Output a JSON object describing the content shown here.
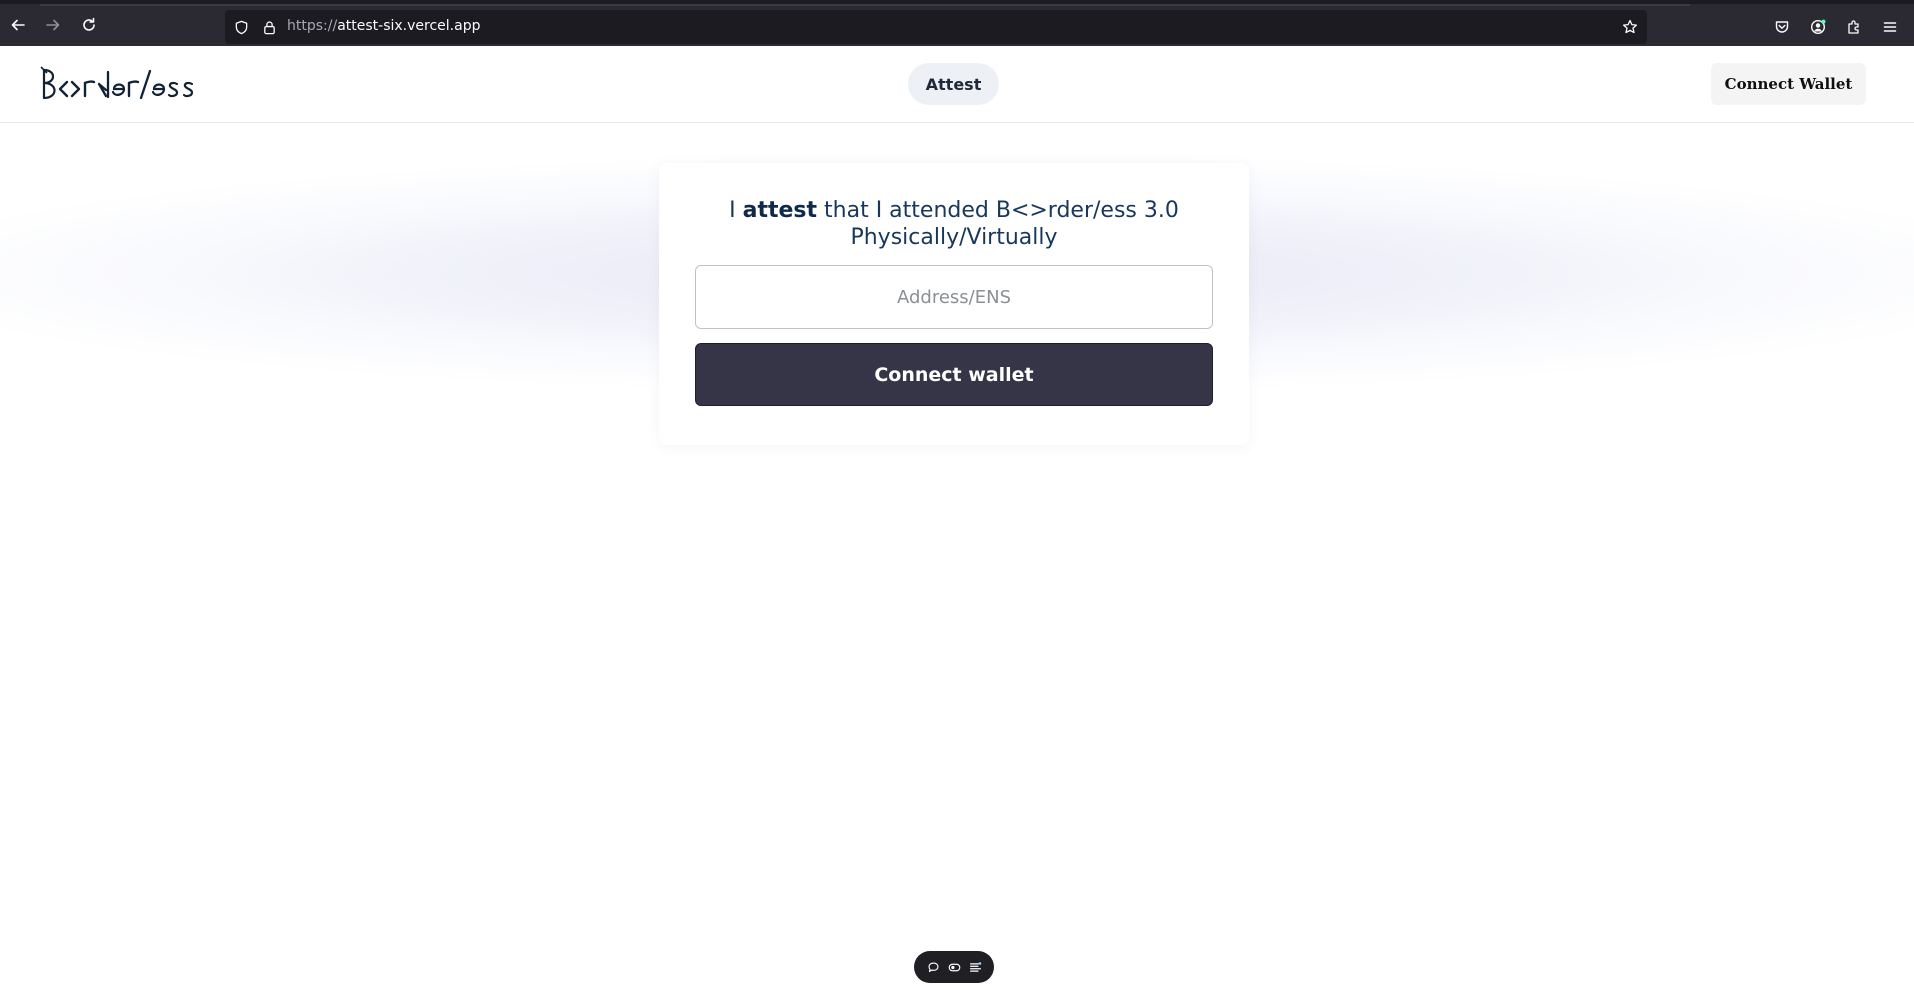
{
  "browser": {
    "url_scheme": "https://",
    "url_host": "attest-six.vercel.app",
    "icons": [
      "back-icon",
      "forward-icon",
      "reload-icon",
      "shield-icon",
      "lock-icon",
      "star-icon",
      "pocket-icon",
      "account-icon",
      "extensions-icon",
      "menu-icon"
    ]
  },
  "header": {
    "logo_text": "B<>rder/ess",
    "nav_label": "Attest",
    "connect_label": "Connect Wallet"
  },
  "card": {
    "heading_prefix": "I ",
    "heading_bold": "attest",
    "heading_rest": " that I attended B<>rder/ess 3.0",
    "heading_line2": "Physically/Virtually",
    "input_placeholder": "Address/ENS",
    "button_label": "Connect wallet"
  },
  "floating_toolbar": {
    "icons": [
      "comment-icon",
      "toggle-icon",
      "list-icon"
    ]
  },
  "colors": {
    "accent_dark": "#363447",
    "heading": "#17385c",
    "browser_chrome": "#2b2a33"
  }
}
